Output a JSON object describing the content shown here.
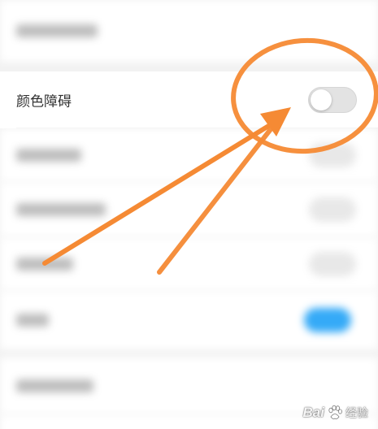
{
  "settings": {
    "color_blind_label": "颜色障碍",
    "color_blind_toggle_on": false
  },
  "colors": {
    "annotation_orange": "#f58a34",
    "toggle_on_blue": "#35aaf7",
    "toggle_off_gray": "#e3e3e3"
  },
  "watermark": {
    "brand": "Bai",
    "suffix": "经验"
  }
}
